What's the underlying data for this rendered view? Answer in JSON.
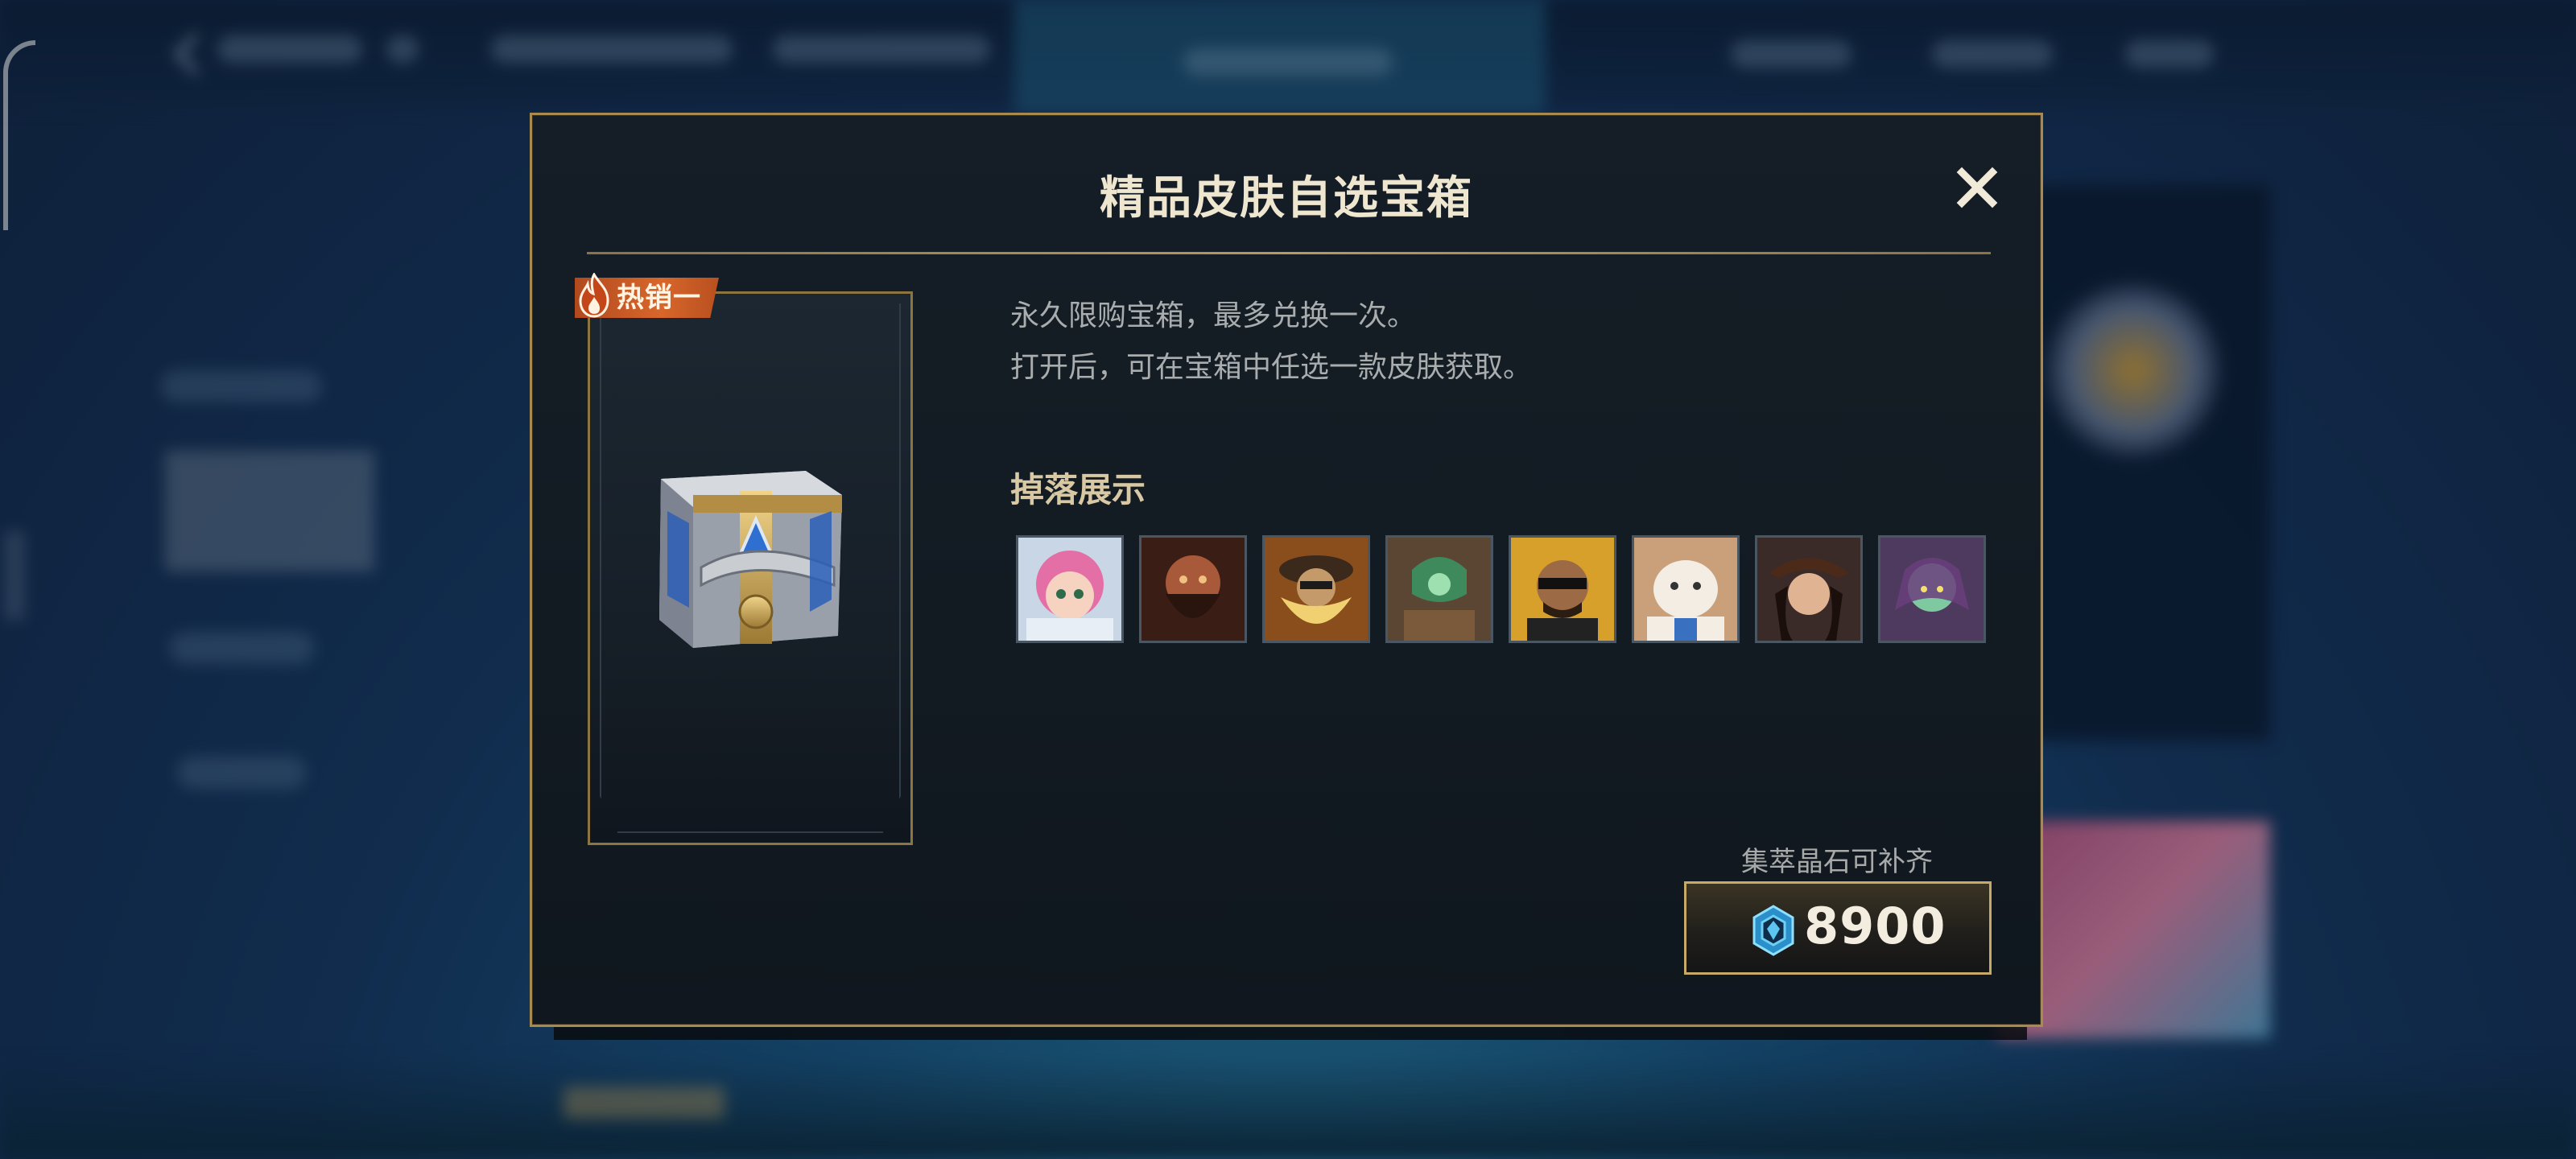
{
  "dialog": {
    "title": "精品皮肤自选宝箱",
    "close_icon": "close-icon"
  },
  "chest": {
    "badge": "热销一",
    "badge_icon": "flame-icon",
    "image": "treasure-chest-icon"
  },
  "description": {
    "line1": "永久限购宝箱，最多兑换一次。",
    "line2": "打开后，可在宝箱中任选一款皮肤获取。"
  },
  "drops": {
    "title": "掉落展示",
    "skins": [
      {
        "icon": "skin-portrait-pink-hair-girl"
      },
      {
        "icon": "skin-portrait-bearded-warrior"
      },
      {
        "icon": "skin-portrait-yellow-bearded-mage"
      },
      {
        "icon": "skin-portrait-green-masked-figure"
      },
      {
        "icon": "skin-portrait-sunglasses-man"
      },
      {
        "icon": "skin-portrait-white-creature"
      },
      {
        "icon": "skin-portrait-pirate-woman"
      },
      {
        "icon": "skin-portrait-green-elf"
      }
    ]
  },
  "price": {
    "note": "集萃晶石可补齐",
    "currency_icon": "crystal-gem-icon",
    "amount": "8900"
  },
  "colors": {
    "gold_border": "#a8894e",
    "badge_orange": "#d8662b",
    "panel_bg": "#151d26"
  }
}
